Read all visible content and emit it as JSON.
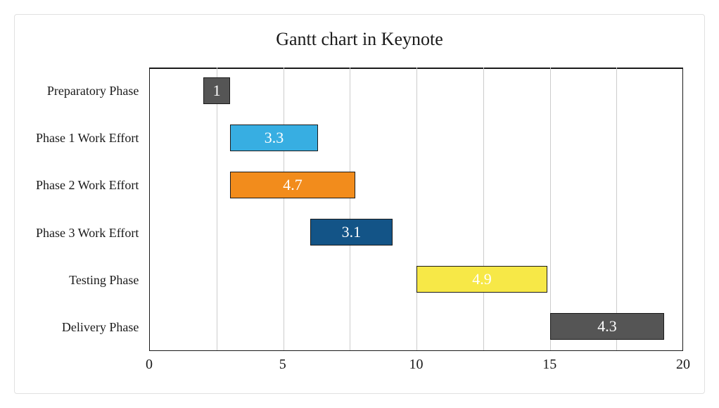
{
  "chart_data": {
    "type": "bar",
    "orientation": "horizontal",
    "gantt": true,
    "title": "Gantt chart in Keynote",
    "xlabel": "",
    "ylabel": "",
    "xlim": [
      0,
      20
    ],
    "x_ticks": [
      0,
      5,
      10,
      15,
      20
    ],
    "categories": [
      "Preparatory Phase",
      "Phase 1 Work Effort",
      "Phase 2 Work Effort",
      "Phase 3 Work Effort",
      "Testing Phase",
      "Delivery Phase"
    ],
    "series": [
      {
        "name": "Preparatory Phase",
        "start": 2,
        "duration": 1,
        "label": "1",
        "color": "#555555"
      },
      {
        "name": "Phase 1 Work Effort",
        "start": 3,
        "duration": 3.3,
        "label": "3.3",
        "color": "#37aee2"
      },
      {
        "name": "Phase 2 Work Effort",
        "start": 3,
        "duration": 4.7,
        "label": "4.7",
        "color": "#f28c1c"
      },
      {
        "name": "Phase 3 Work Effort",
        "start": 6,
        "duration": 3.1,
        "label": "3.1",
        "color": "#135487"
      },
      {
        "name": "Testing Phase",
        "start": 10,
        "duration": 4.9,
        "label": "4.9",
        "color": "#f7e847"
      },
      {
        "name": "Delivery Phase",
        "start": 15,
        "duration": 4.3,
        "label": "4.3",
        "color": "#555555"
      }
    ]
  }
}
